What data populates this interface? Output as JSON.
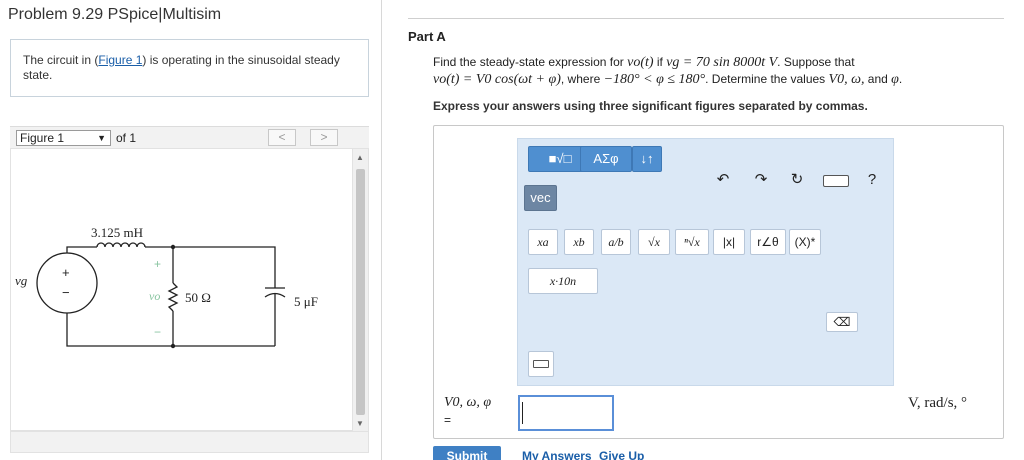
{
  "problem": {
    "title": "Problem 9.29 PSpice|Multisim",
    "description_pre": "The circuit in (",
    "description_link": "Figure 1",
    "description_post": ") is operating in the sinusoidal steady state."
  },
  "figure_nav": {
    "selected": "Figure 1",
    "of_label": "of 1",
    "prev": "<",
    "next": ">"
  },
  "circuit": {
    "source_label": "vg",
    "source_plus": "+",
    "source_minus": "−",
    "inductor_label": "3.125 mH",
    "output_label": "vo",
    "output_plus": "+",
    "output_minus": "−",
    "resistor_label": "50 Ω",
    "capacitor_label": "5 μF"
  },
  "part": {
    "title": "Part A",
    "q_line1_a": "Find the steady-state expression for ",
    "q_vo": "vo(t)",
    "q_line1_b": " if ",
    "q_vg": "vg = 70 sin 8000t V",
    "q_line1_c": ". Suppose that",
    "q_line2_a": "vo(t) = V0 cos(ωt + φ)",
    "q_line2_b": ", where ",
    "q_line2_c": "−180° < φ ≤ 180°",
    "q_line2_d": ". Determine the values ",
    "q_line2_e": "V0, ω,",
    "q_line2_f": " and ",
    "q_line2_g": "φ",
    "q_line2_h": ".",
    "instruction": "Express your answers using three significant figures separated by commas."
  },
  "toolbar": {
    "templates_label": "■√□",
    "greek_label": "ΑΣφ",
    "arrows_label": "↓↑",
    "vec_label": "vec",
    "undo_icon": "undo-icon",
    "redo_icon": "redo-icon",
    "reset_icon": "reset-icon",
    "keyboard_icon": "keyboard-icon",
    "help_label": "?",
    "btn_power": "xa",
    "btn_subscript": "xb",
    "btn_fraction": "a/b",
    "btn_sqrt": "√x",
    "btn_nthroot": "ⁿ√x",
    "btn_abs": "|x|",
    "btn_polar": "r∠θ",
    "btn_conj": "(X)*",
    "btn_sci": "x·10n",
    "backspace_icon": "backspace-icon"
  },
  "answer": {
    "label": "V0, ω, φ",
    "equals": "=",
    "value": "",
    "units": "V, rad/s, °"
  },
  "actions": {
    "submit": "Submit",
    "my_answers": "My Answers",
    "give_up": "Give Up"
  }
}
